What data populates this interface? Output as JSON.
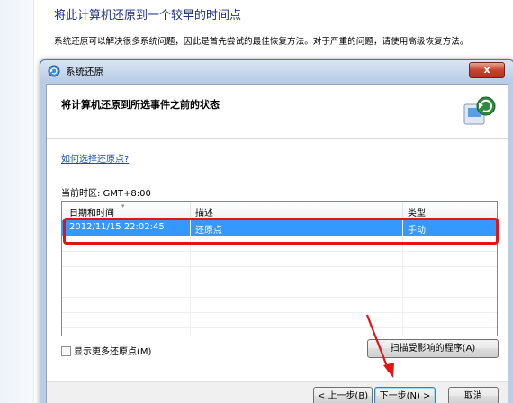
{
  "page": {
    "heading": "将此计算机还原到一个较早的时间点",
    "description": "系统还原可以解决很多系统问题，因此是首先尝试的最佳恢复方法。对于严重的问题，请使用高级恢复方法。"
  },
  "dialog": {
    "title": "系统还原",
    "close_label": "x",
    "heading": "将计算机还原到所选事件之前的状态",
    "help_link": "如何选择还原点?",
    "timezone": "当前时区: GMT+8:00",
    "columns": [
      "日期和时间",
      "描述",
      "类型"
    ],
    "rows": [
      {
        "datetime": "2012/11/15 22:02:45",
        "description": "还原点",
        "type": "手动",
        "selected": true
      }
    ],
    "show_more_label": "显示更多还原点(M)",
    "scan_button": "扫描受影响的程序(A)",
    "back_button": "< 上一步(B)",
    "next_button": "下一步(N) >",
    "cancel_button": "取消"
  },
  "colors": {
    "selection": "#3399ff",
    "annotation": "#e31414",
    "heading": "#1e3287"
  },
  "icons": [
    "system-restore-icon",
    "close-icon",
    "restore-wizard-icon",
    "sort-arrow-icon"
  ]
}
